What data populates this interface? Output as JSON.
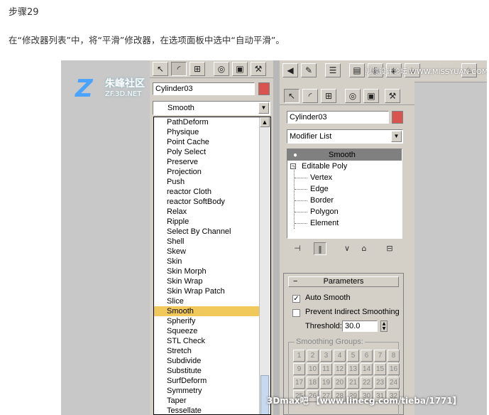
{
  "article": {
    "step": "步骤29",
    "instruction": "在“修改器列表”中，将“平滑”修改器，在选项面板中选中“自动平滑”。"
  },
  "left_panel": {
    "object_name": "Cylinder03",
    "combo_value": "Smooth",
    "modifier_list": [
      "PathDeform",
      "Physique",
      "Point Cache",
      "Poly Select",
      "Preserve",
      "Projection",
      "Push",
      "reactor Cloth",
      "reactor SoftBody",
      "Relax",
      "Ripple",
      "Select By Channel",
      "Shell",
      "Skew",
      "Skin",
      "Skin Morph",
      "Skin Wrap",
      "Skin Wrap Patch",
      "Slice",
      "Smooth",
      "Spherify",
      "Squeeze",
      "STL Check",
      "Stretch",
      "Subdivide",
      "Substitute",
      "SurfDeform",
      "Symmetry",
      "Taper",
      "Tessellate"
    ],
    "selected_modifier": "Smooth",
    "selected_color": "#f0c95a"
  },
  "right_panel": {
    "object_name": "Cylinder03",
    "modifier_list_label": "Modifier List",
    "stack_top": "Smooth",
    "stack_base": "Editable Poly",
    "sub_objects": [
      "Vertex",
      "Edge",
      "Border",
      "Polygon",
      "Element"
    ],
    "rollout_title": "Parameters",
    "auto_smooth_label": "Auto Smooth",
    "auto_smooth_checked": true,
    "prevent_indirect_label": "Prevent Indirect Smoothing",
    "prevent_indirect_checked": false,
    "threshold_label": "Threshold:",
    "threshold_value": "30.0",
    "smoothing_groups_label": "Smoothing Groups:",
    "smoothing_groups": [
      "1",
      "2",
      "3",
      "4",
      "5",
      "6",
      "7",
      "8",
      "9",
      "10",
      "11",
      "12",
      "13",
      "14",
      "15",
      "16",
      "17",
      "18",
      "19",
      "20",
      "21",
      "22",
      "23",
      "24",
      "25",
      "26",
      "27",
      "28",
      "29",
      "30",
      "31",
      "32"
    ]
  },
  "watermarks": {
    "top": "思缘设计论坛 WWW.MISSYUAN.COM",
    "logo_text": "朱峰社区",
    "logo_sub": "ZF.3D.NET",
    "bottom": "3Dmax吧 【www.linecg.com/tieba/1771】"
  },
  "colors": {
    "accent_swatch": "#d9534f",
    "panel_bg": "#d4d0c8"
  }
}
